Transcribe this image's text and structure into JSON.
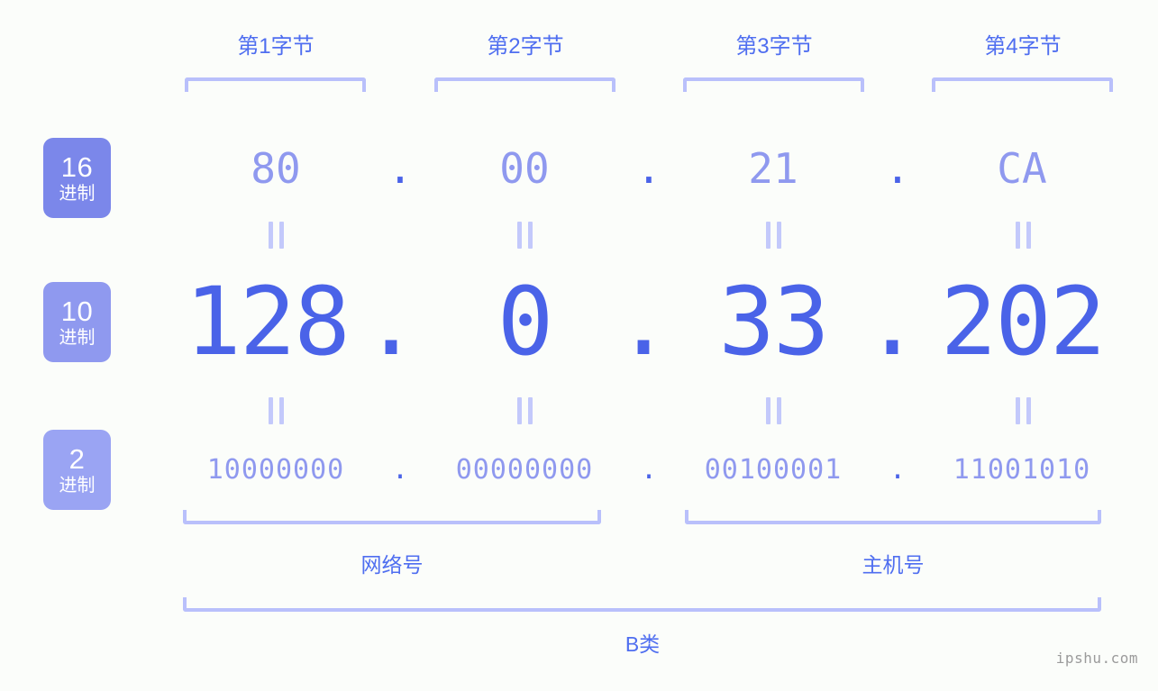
{
  "watermark": "ipshu.com",
  "byte_headers": [
    {
      "label": "第1字节"
    },
    {
      "label": "第2字节"
    },
    {
      "label": "第3字节"
    },
    {
      "label": "第4字节"
    }
  ],
  "badges": [
    {
      "num": "16",
      "sub": "进制",
      "color": "#7b87ea"
    },
    {
      "num": "10",
      "sub": "进制",
      "color": "#8f99ef"
    },
    {
      "num": "2",
      "sub": "进制",
      "color": "#9aa4f3"
    }
  ],
  "rows": {
    "hex": {
      "base": "16",
      "values": [
        "80",
        "00",
        "21",
        "CA"
      ],
      "separator": "."
    },
    "decimal": {
      "base": "10",
      "values": [
        "128",
        "0",
        "33",
        "202"
      ],
      "separator": "."
    },
    "binary": {
      "base": "2",
      "values": [
        "10000000",
        "00000000",
        "00100001",
        "11001010"
      ],
      "separator": "."
    }
  },
  "equals_symbol": "=",
  "segments": [
    {
      "label": "网络号"
    },
    {
      "label": "主机号"
    }
  ],
  "ip_class": {
    "label": "B类"
  },
  "colors": {
    "accent": "#4a63e8",
    "accent_light": "#8f99ef",
    "bracket": "#b9c0fb",
    "heading": "#4f6ef0",
    "background": "#fbfdfa"
  }
}
